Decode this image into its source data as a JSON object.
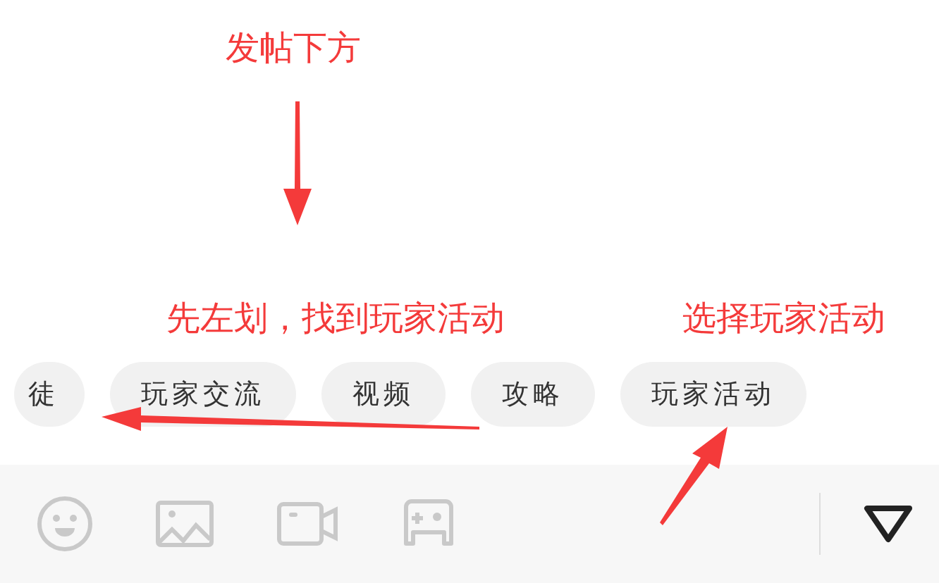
{
  "annotations": [
    {
      "text": "发帖下方"
    },
    {
      "text": "先左划，找到玩家活动"
    },
    {
      "text": "选择玩家活动"
    }
  ],
  "topics": [
    {
      "label": "徒"
    },
    {
      "label": "玩家交流"
    },
    {
      "label": "视频"
    },
    {
      "label": "攻略"
    },
    {
      "label": "玩家活动"
    }
  ]
}
